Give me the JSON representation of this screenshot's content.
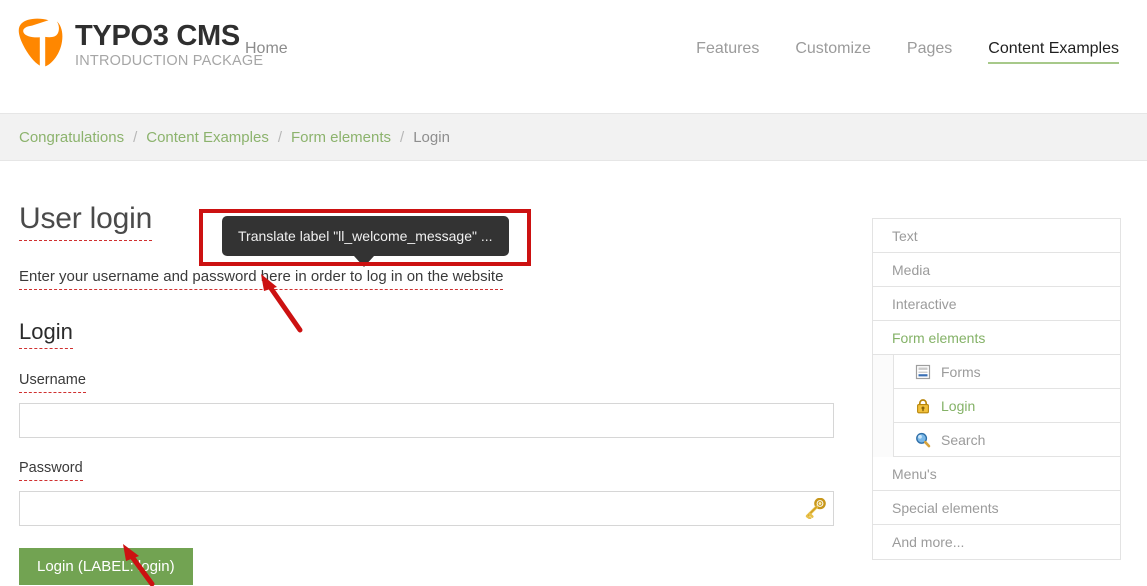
{
  "header": {
    "logo_icon": "typo3-logo-icon",
    "brand_title": "TYPO3 CMS",
    "brand_subtitle": "INTRODUCTION PACKAGE",
    "home_label": "Home",
    "nav_items": [
      {
        "label": "Features",
        "active": false
      },
      {
        "label": "Customize",
        "active": false
      },
      {
        "label": "Pages",
        "active": false
      },
      {
        "label": "Content Examples",
        "active": true
      }
    ],
    "accent_color": "#a7c98a",
    "logo_color": "#ff8700"
  },
  "breadcrumb": {
    "separator": "/",
    "items": [
      {
        "label": "Congratulations",
        "current": false
      },
      {
        "label": "Content Examples",
        "current": false
      },
      {
        "label": "Form elements",
        "current": false
      },
      {
        "label": "Login",
        "current": true
      }
    ],
    "link_color": "#8cb36d",
    "current_color": "#8e8e8e"
  },
  "main": {
    "page_title": "User login",
    "welcome_message": "Enter your username and password here in order to log in on the website",
    "section_title": "Login",
    "username_label": "Username",
    "username_value": "",
    "username_placeholder": "",
    "password_label": "Password",
    "password_value": "",
    "password_placeholder": "",
    "password_icon": "key-icon",
    "submit_label": "Login (LABEL: login)",
    "submit_color": "#72a352"
  },
  "tooltip": {
    "text": "Translate label \"ll_welcome_message\" ...",
    "background": "#333333",
    "text_color": "#f0f0f0"
  },
  "annotations": {
    "highlight_color": "#cc1111",
    "rect_label": "tooltip-highlight-rect",
    "arrow_1_label": "arrow-to-welcome-message",
    "arrow_2_label": "arrow-to-login-button"
  },
  "sidebar": {
    "items": [
      {
        "label": "Text",
        "active": false,
        "icon": null
      },
      {
        "label": "Media",
        "active": false,
        "icon": null
      },
      {
        "label": "Interactive",
        "active": false,
        "icon": null
      },
      {
        "label": "Form elements",
        "active": true,
        "icon": null
      }
    ],
    "sub_items": [
      {
        "label": "Forms",
        "active": false,
        "icon": "document-icon"
      },
      {
        "label": "Login",
        "active": true,
        "icon": "padlock-icon"
      },
      {
        "label": "Search",
        "active": false,
        "icon": "magnifier-icon"
      }
    ],
    "items_after": [
      {
        "label": "Menu's",
        "active": false,
        "icon": null
      },
      {
        "label": "Special elements",
        "active": false,
        "icon": null
      },
      {
        "label": "And more...",
        "active": false,
        "icon": null
      }
    ],
    "active_color": "#84b267",
    "inactive_color": "#9b9b9b"
  }
}
